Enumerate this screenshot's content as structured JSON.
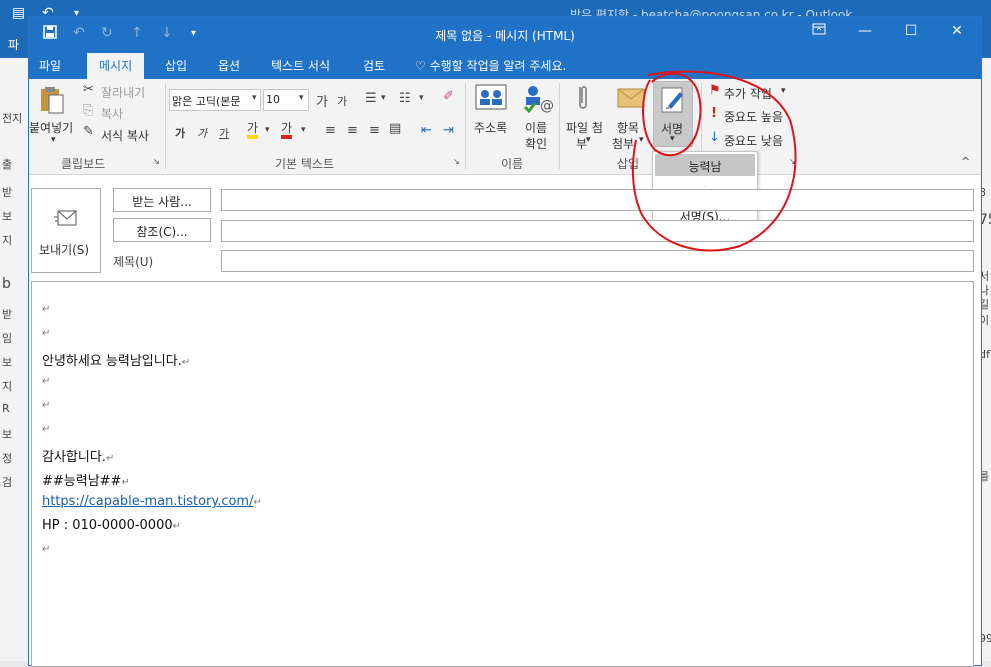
{
  "background": {
    "title": "받은 편지함 - beatcha@poongsan.co.kr - Outlook",
    "tab": "파",
    "left_items": [
      "전지",
      "출",
      "받",
      "보",
      "지",
      "b",
      "받",
      "임",
      "보",
      "지",
      "R",
      "보",
      "정",
      "검"
    ],
    "right_items": [
      "8",
      "75",
      "서",
      "나",
      "길",
      "이",
      "df",
      "를",
      "99"
    ]
  },
  "window": {
    "title": "제목 없음 - 메시지 (HTML)",
    "tabs": [
      "파일",
      "메시지",
      "삽입",
      "옵션",
      "텍스트 서식",
      "검토"
    ],
    "tell_me": "수행할 작업을 알려 주세요."
  },
  "ribbon": {
    "clipboard": {
      "paste": "붙여넣기",
      "cut": "잘라내기",
      "copy": "복사",
      "format_painter": "서식 복사",
      "label": "클립보드"
    },
    "basic_text": {
      "font": "맑은 고딕(본문",
      "size": "10",
      "label": "기본 텍스트"
    },
    "names": {
      "address_book": "주소록",
      "check_names_1": "이름",
      "check_names_2": "확인",
      "label": "이름"
    },
    "include": {
      "attach_file_1": "파일 첨",
      "attach_file_2": "부",
      "attach_item_1": "항목",
      "attach_item_2": "첨부",
      "signature": "서명",
      "label": "삽입"
    },
    "tags": {
      "follow_up": "추가 작업",
      "high_importance": "중요도 높음",
      "low_importance": "중요도 낮음"
    }
  },
  "signature_menu": {
    "items": [
      "능력남",
      "·"
    ],
    "signatures_link": "서명(S)..."
  },
  "header": {
    "send": "보내기(S)",
    "to": "받는 사람...",
    "cc": "참조(C)...",
    "subject": "제목(U)"
  },
  "message": {
    "greeting": "안녕하세요 능력남입니다.",
    "thanks": "감사합니다.",
    "signature_name": "##능력남##",
    "url": "https://capable-man.tistory.com/",
    "phone": "HP : 010-0000-0000"
  },
  "colors": {
    "accent": "#1f72c6",
    "annotation": "#e0131a",
    "highlight": "#ffd800",
    "font_color": "#e02020"
  }
}
